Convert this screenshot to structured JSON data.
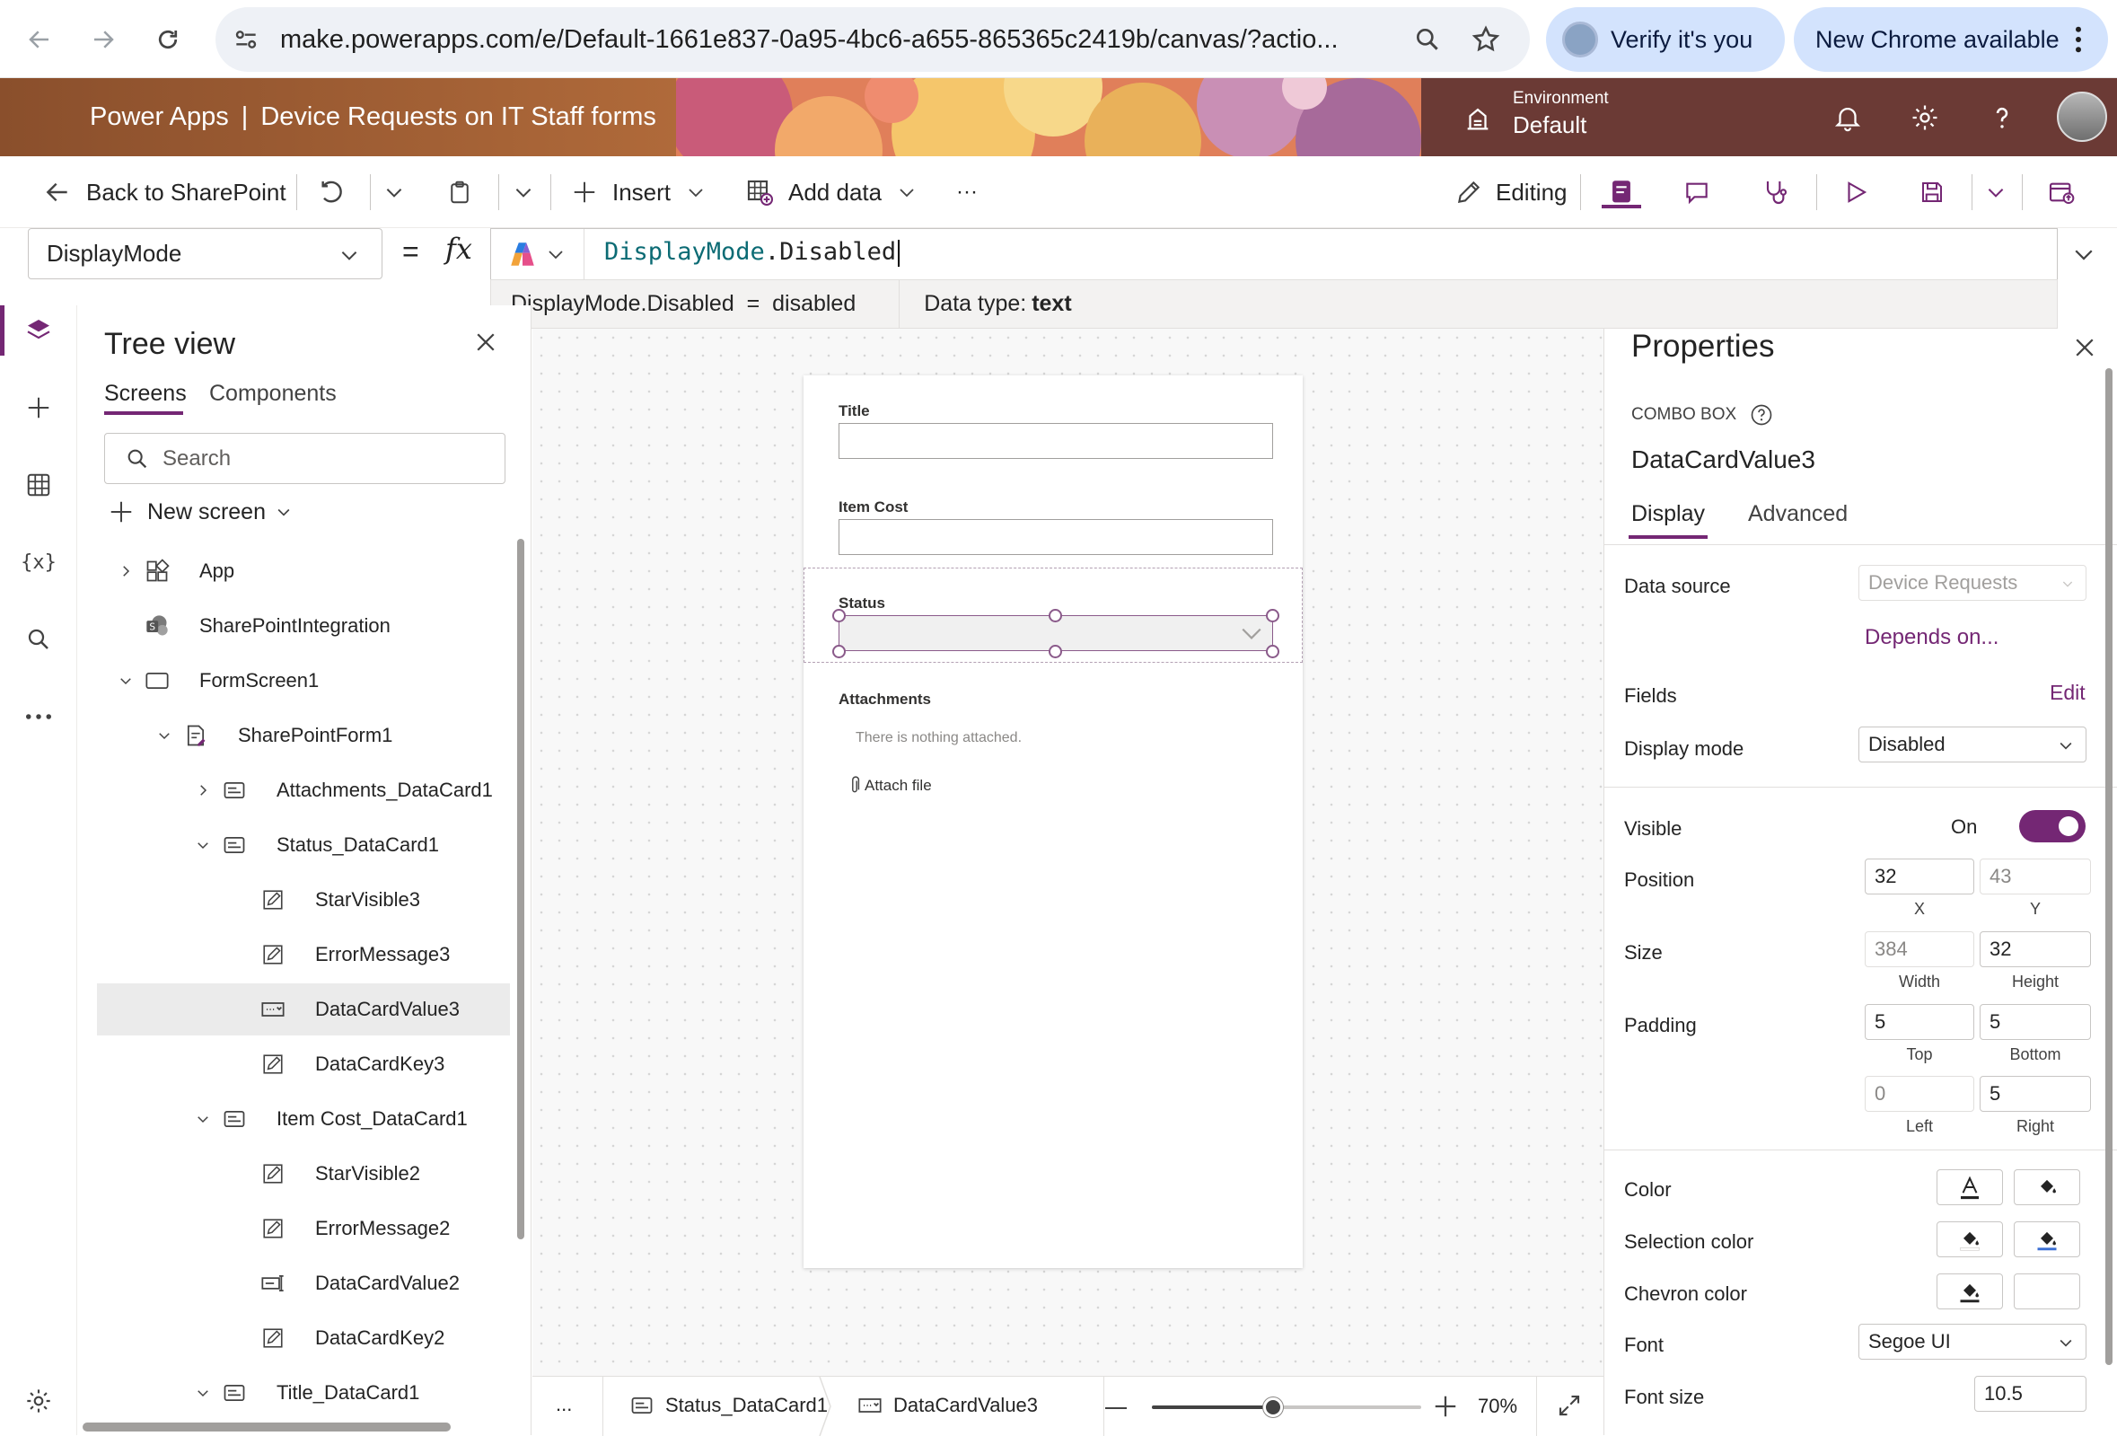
{
  "browser": {
    "url": "make.powerapps.com/e/Default-1661e837-0a95-4bc6-a655-865365c2419b/canvas/?actio...",
    "verify_label": "Verify it's you",
    "update_label": "New Chrome available"
  },
  "header": {
    "app_name": "Power Apps",
    "separator": "|",
    "doc_title": "Device Requests on IT Staff forms",
    "env_label": "Environment",
    "env_value": "Default"
  },
  "commands": {
    "back": "Back to SharePoint",
    "insert": "Insert",
    "add_data": "Add data",
    "more": "···",
    "editing": "Editing"
  },
  "formula": {
    "property": "DisplayMode",
    "equals": "=",
    "fx": "fx",
    "token1": "DisplayMode",
    "dot": ".",
    "token2": "Disabled",
    "hint_expr": "DisplayMode.Disabled  =  disabled",
    "hint_type_label": "Data type: ",
    "hint_type_value": "text"
  },
  "tree": {
    "title": "Tree view",
    "tabs": [
      "Screens",
      "Components"
    ],
    "search_placeholder": "Search",
    "new_screen": "New screen",
    "items": [
      {
        "label": "App"
      },
      {
        "label": "SharePointIntegration"
      },
      {
        "label": "FormScreen1"
      },
      {
        "label": "SharePointForm1"
      },
      {
        "label": "Attachments_DataCard1"
      },
      {
        "label": "Status_DataCard1"
      },
      {
        "label": "StarVisible3"
      },
      {
        "label": "ErrorMessage3"
      },
      {
        "label": "DataCardValue3"
      },
      {
        "label": "DataCardKey3"
      },
      {
        "label": "Item Cost_DataCard1"
      },
      {
        "label": "StarVisible2"
      },
      {
        "label": "ErrorMessage2"
      },
      {
        "label": "DataCardValue2"
      },
      {
        "label": "DataCardKey2"
      },
      {
        "label": "Title_DataCard1"
      }
    ]
  },
  "form": {
    "title_label": "Title",
    "cost_label": "Item Cost",
    "status_label": "Status",
    "attachments_label": "Attachments",
    "attachments_empty": "There is nothing attached.",
    "attach_file": "Attach file"
  },
  "statusbar": {
    "more": "...",
    "crumb1": "Status_DataCard1",
    "crumb2": "DataCardValue3",
    "zoom": "70%",
    "zoom_level": 0.45
  },
  "properties": {
    "title": "Properties",
    "control_type": "COMBO BOX",
    "control_name": "DataCardValue3",
    "tabs": [
      "Display",
      "Advanced"
    ],
    "data_source_label": "Data source",
    "data_source_value": "Device Requests",
    "depends_on": "Depends on...",
    "fields_label": "Fields",
    "fields_edit": "Edit",
    "display_mode_label": "Display mode",
    "display_mode_value": "Disabled",
    "visible_label": "Visible",
    "visible_state": "On",
    "position_label": "Position",
    "position_x": "32",
    "position_y": "43",
    "x_caption": "X",
    "y_caption": "Y",
    "size_label": "Size",
    "size_width": "384",
    "size_height": "32",
    "width_caption": "Width",
    "height_caption": "Height",
    "padding_label": "Padding",
    "padding_top": "5",
    "padding_bottom": "5",
    "padding_left": "0",
    "padding_right": "5",
    "top_caption": "Top",
    "bottom_caption": "Bottom",
    "left_caption": "Left",
    "right_caption": "Right",
    "color_label": "Color",
    "selection_color_label": "Selection color",
    "chevron_color_label": "Chevron color",
    "font_label": "Font",
    "font_value": "Segoe UI",
    "font_size_label": "Font size",
    "font_size_value": "10.5",
    "accent_color": "#742774",
    "selection_underline_color": "#3b6fd4"
  }
}
